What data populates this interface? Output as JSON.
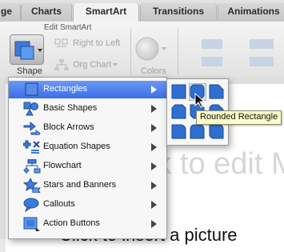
{
  "tabs": [
    {
      "label": "ge"
    },
    {
      "label": "Charts"
    },
    {
      "label": "SmartArt",
      "active": true
    },
    {
      "label": "Transitions"
    },
    {
      "label": "Animations"
    }
  ],
  "ribbon": {
    "group_label": "Edit SmartArt",
    "shape_label": "Shape",
    "right_to_left": "Right to Left",
    "org_chart": "Org Chart",
    "colors": "Colors"
  },
  "slide": {
    "title_placeholder": "Click to edit M",
    "body_placeholder": "Click to insert a picture"
  },
  "menu": {
    "items": [
      {
        "label": "Rectangles",
        "icon": "rectangle-icon"
      },
      {
        "label": "Basic Shapes",
        "icon": "basic-shapes-icon"
      },
      {
        "label": "Block Arrows",
        "icon": "block-arrows-icon"
      },
      {
        "label": "Equation Shapes",
        "icon": "equation-shapes-icon"
      },
      {
        "label": "Flowchart",
        "icon": "flowchart-icon"
      },
      {
        "label": "Stars and Banners",
        "icon": "star-icon"
      },
      {
        "label": "Callouts",
        "icon": "callout-icon"
      },
      {
        "label": "Action Buttons",
        "icon": "action-button-icon"
      }
    ]
  },
  "submenu": {
    "tooltip": "Rounded Rectangle"
  },
  "colors": {
    "accent": "#3a6fe9",
    "shape_fill": "#2e6fcf"
  }
}
